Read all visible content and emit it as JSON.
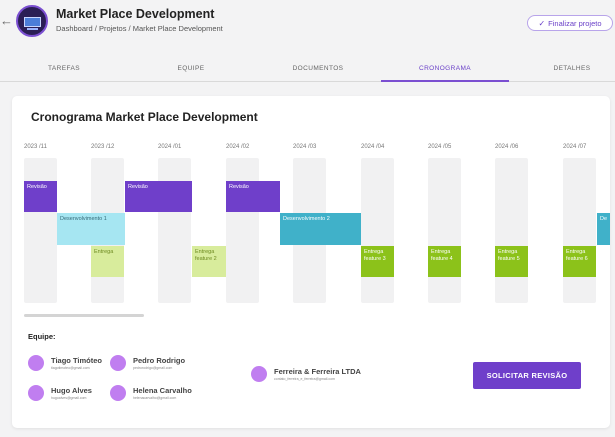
{
  "header": {
    "title": "Market Place Development",
    "breadcrumb": "Dashboard / Projetos / Market Place Development",
    "finalize_label": "Finalizar projeto"
  },
  "tabs": [
    {
      "label": "TAREFAS"
    },
    {
      "label": "EQUIPE"
    },
    {
      "label": "DOCUMENTOS"
    },
    {
      "label": "CRONOGRAMA",
      "active": true
    },
    {
      "label": "DETALHES"
    }
  ],
  "schedule": {
    "title": "Cronograma Market Place Development",
    "months": [
      "2023 /11",
      "2023 /12",
      "2024 /01",
      "2024 /02",
      "2024 /03",
      "2024 /04",
      "2024 /05",
      "2024 /06",
      "2024 /07"
    ],
    "bars": [
      {
        "label": "Revisão"
      },
      {
        "label": "Revisão"
      },
      {
        "label": "Revisão"
      },
      {
        "label": "Desenvolvimento 1"
      },
      {
        "label": "Desenvolvimento 2"
      },
      {
        "label": "De"
      },
      {
        "label": "Entrega"
      },
      {
        "label": "Entrega feature 2"
      },
      {
        "label": "Entrega feature 3"
      },
      {
        "label": "Entrega feature 4"
      },
      {
        "label": "Entrega feature 5"
      },
      {
        "label": "Entrega feature 6"
      }
    ]
  },
  "team": {
    "label": "Equipe:",
    "members": [
      {
        "name": "Tiago Timóteo",
        "email": "tiagotimoteo@gmail.com"
      },
      {
        "name": "Pedro Rodrigo",
        "email": "pedrorodrigo@gmail.com"
      },
      {
        "name": "Hugo Alves",
        "email": "hugoalves@gmail.com"
      },
      {
        "name": "Helena Carvalho",
        "email": "helenacarvalho@gmail.com"
      },
      {
        "name": "Ferreira & Ferreira LTDA",
        "email": "contato_ferreira_e_ferreira@gmail.com"
      }
    ]
  },
  "actions": {
    "request_review": "SOLICITAR REVISÃO"
  },
  "colors": {
    "accent": "#6f3fca",
    "avatar": "#c07ef0",
    "dev1": "#a6e6f2",
    "dev2": "#40b1c9",
    "delivery_light": "#d8ec9c",
    "delivery": "#8cc21a"
  }
}
